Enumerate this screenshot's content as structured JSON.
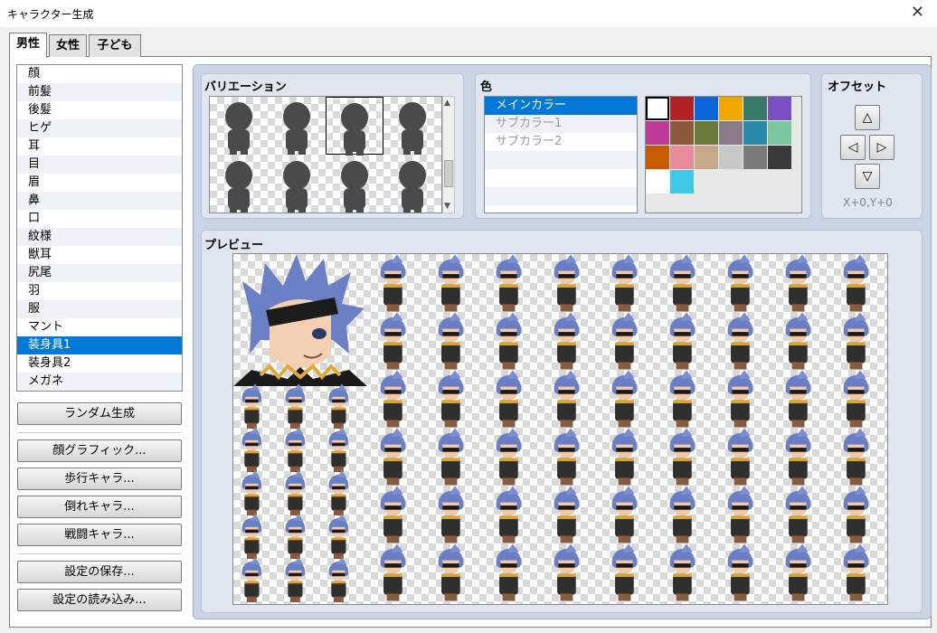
{
  "window": {
    "title": "キャラクター生成",
    "close_glyph": "✕"
  },
  "tabs": [
    {
      "label": "男性",
      "active": true
    },
    {
      "label": "女性",
      "active": false
    },
    {
      "label": "子ども",
      "active": false
    }
  ],
  "parts": {
    "selected_index": 15,
    "items": [
      "顔",
      "前髪",
      "後髪",
      "ヒゲ",
      "耳",
      "目",
      "眉",
      "鼻",
      "口",
      "紋様",
      "獣耳",
      "尻尾",
      "羽",
      "服",
      "マント",
      "装身具1",
      "装身具2",
      "メガネ"
    ]
  },
  "buttons": {
    "random": "ランダム生成",
    "face_graphic": "顔グラフィック...",
    "walk_chara": "歩行キャラ...",
    "down_chara": "倒れキャラ...",
    "battle_chara": "戦闘キャラ...",
    "save_settings": "設定の保存...",
    "load_settings": "設定の読み込み..."
  },
  "variation": {
    "title": "バリエーション",
    "selected_index": 2
  },
  "color": {
    "title": "色",
    "items": [
      "メインカラー",
      "サブカラー1",
      "サブカラー2"
    ],
    "selected_index": 0,
    "swatches": [
      [
        "#ffffff",
        "#b22222",
        "#0a66d8",
        "#f0a800",
        "#3a7a6a",
        "#7a4fc4"
      ],
      [
        "#c03a9a",
        "#8a5a3a",
        "#6a7a3a",
        "#8a7a8a",
        "#2a8aaa",
        "#7ac8a0"
      ],
      [
        "#c85a00",
        "#e88a9a",
        "#c8a888",
        "#c8c8c8",
        "#7a7a7a",
        "#3a3a3a"
      ],
      [
        "#ffffff",
        "#40c8e8"
      ]
    ],
    "selected_swatch": [
      0,
      0
    ]
  },
  "offset": {
    "title": "オフセット",
    "up": "△",
    "down": "▽",
    "left": "◁",
    "right": "▷",
    "value": "X+0,Y+0"
  },
  "preview": {
    "title": "プレビュー"
  }
}
